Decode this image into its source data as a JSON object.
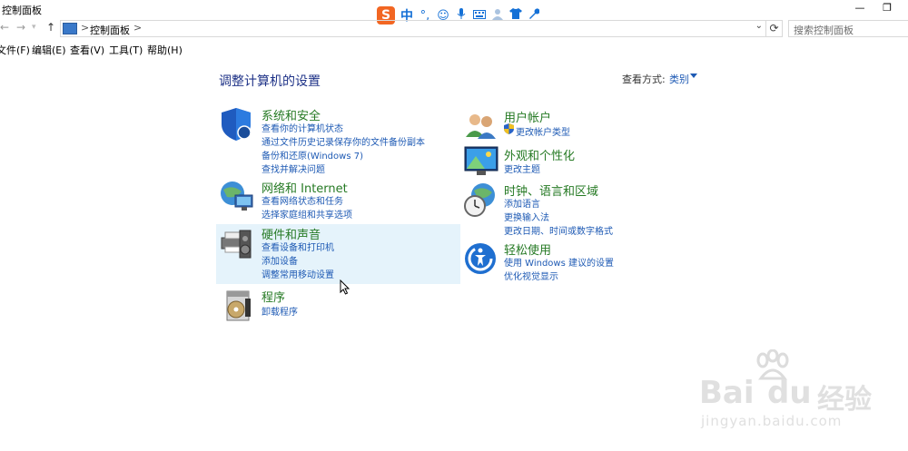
{
  "window": {
    "title": "控制面板",
    "minimize_glyph": "—",
    "restore_glyph": "❐"
  },
  "ime": {
    "zh_label": "中",
    "logo_letter": "S",
    "icons": [
      "punctuation-icon",
      "emoji-icon",
      "microphone-icon",
      "keyboard-icon",
      "user-icon",
      "skin-icon",
      "settings-wrench-icon"
    ]
  },
  "address": {
    "path": "控制面板",
    "separator": ">"
  },
  "search": {
    "placeholder": "搜索控制面板"
  },
  "menu": {
    "file": "文件(F)",
    "edit": "编辑(E)",
    "view": "查看(V)",
    "tools": "工具(T)",
    "help": "帮助(H)"
  },
  "heading": "调整计算机的设置",
  "view_by": {
    "label": "查看方式:",
    "value": "类别"
  },
  "categories": {
    "system": {
      "title": "系统和安全",
      "links": [
        "查看你的计算机状态",
        "通过文件历史记录保存你的文件备份副本",
        "备份和还原(Windows 7)",
        "查找并解决问题"
      ]
    },
    "network": {
      "title": "网络和 Internet",
      "links": [
        "查看网络状态和任务",
        "选择家庭组和共享选项"
      ]
    },
    "hardware": {
      "title": "硬件和声音",
      "links": [
        "查看设备和打印机",
        "添加设备",
        "调整常用移动设置"
      ]
    },
    "programs": {
      "title": "程序",
      "links": [
        "卸载程序"
      ]
    },
    "accounts": {
      "title": "用户帐户",
      "links": [
        "更改帐户类型"
      ]
    },
    "appearance": {
      "title": "外观和个性化",
      "links": [
        "更改主题"
      ]
    },
    "clock": {
      "title": "时钟、语言和区域",
      "links": [
        "添加语言",
        "更换输入法",
        "更改日期、时间或数字格式"
      ]
    },
    "ease": {
      "title": "轻松使用",
      "links": [
        "使用 Windows 建议的设置",
        "优化视觉显示"
      ]
    }
  },
  "watermark": {
    "brand": "Bai",
    "brand2": "du",
    "suffix": "经验",
    "url": "jingyan.baidu.com"
  },
  "colors": {
    "category_title": "#267a24",
    "link": "#1e5ab4",
    "heading": "#1e3287",
    "hover": "#e5f3fb"
  }
}
